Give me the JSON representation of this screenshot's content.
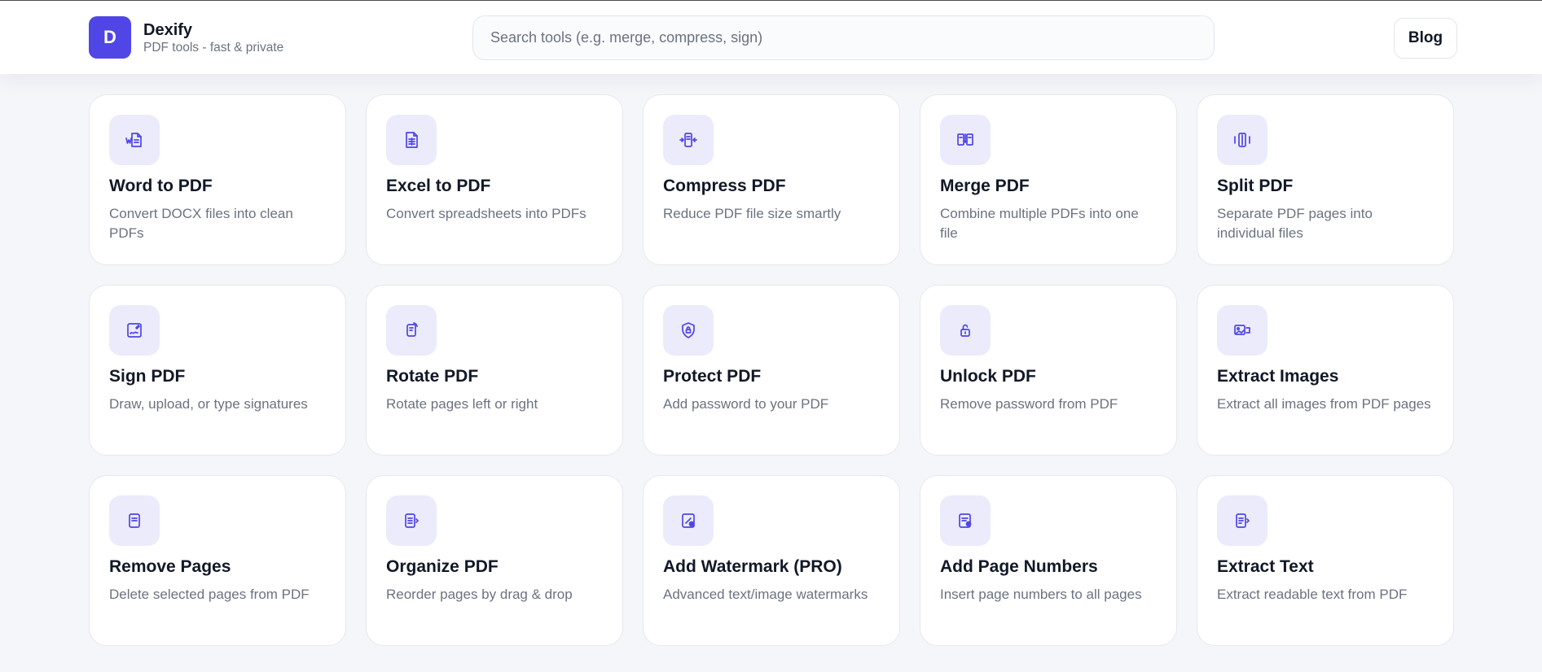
{
  "header": {
    "logo_letter": "D",
    "app_name": "Dexify",
    "tagline": "PDF tools - fast & private",
    "search_placeholder": "Search tools (e.g. merge, compress, sign)",
    "blog_label": "Blog"
  },
  "colors": {
    "accent": "#4f46e5",
    "icon_bg": "#ecebfc",
    "page_bg": "#f5f6fa",
    "text": "#111827",
    "muted": "#6b7280"
  },
  "tools": [
    {
      "title": "Word to PDF",
      "desc": "Convert DOCX files into clean PDFs",
      "icon": "word-doc-icon"
    },
    {
      "title": "Excel to PDF",
      "desc": "Convert spreadsheets into PDFs",
      "icon": "spreadsheet-icon"
    },
    {
      "title": "Compress PDF",
      "desc": "Reduce PDF file size smartly",
      "icon": "compress-icon"
    },
    {
      "title": "Merge PDF",
      "desc": "Combine multiple PDFs into one file",
      "icon": "merge-icon"
    },
    {
      "title": "Split PDF",
      "desc": "Separate PDF pages into individual files",
      "icon": "split-icon"
    },
    {
      "title": "Sign PDF",
      "desc": "Draw, upload, or type signatures",
      "icon": "signature-icon"
    },
    {
      "title": "Rotate PDF",
      "desc": "Rotate pages left or right",
      "icon": "rotate-icon"
    },
    {
      "title": "Protect PDF",
      "desc": "Add password to your PDF",
      "icon": "shield-lock-icon"
    },
    {
      "title": "Unlock PDF",
      "desc": "Remove password from PDF",
      "icon": "unlock-icon"
    },
    {
      "title": "Extract Images",
      "desc": "Extract all images from PDF pages",
      "icon": "images-icon"
    },
    {
      "title": "Remove Pages",
      "desc": "Delete selected pages from PDF",
      "icon": "page-remove-icon"
    },
    {
      "title": "Organize PDF",
      "desc": "Reorder pages by drag & drop",
      "icon": "organize-icon"
    },
    {
      "title": "Add Watermark (PRO)",
      "desc": "Advanced text/image watermarks",
      "icon": "watermark-icon"
    },
    {
      "title": "Add Page Numbers",
      "desc": "Insert page numbers to all pages",
      "icon": "page-number-icon"
    },
    {
      "title": "Extract Text",
      "desc": "Extract readable text from PDF",
      "icon": "text-extract-icon"
    }
  ]
}
